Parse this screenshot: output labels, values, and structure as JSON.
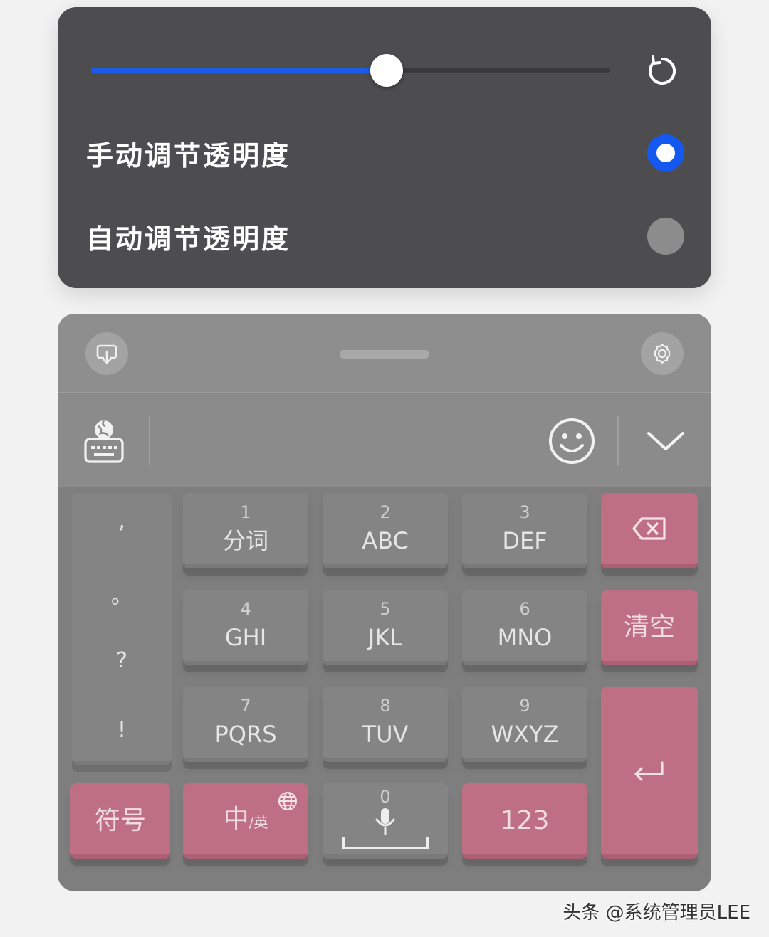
{
  "transparency_panel": {
    "slider_level": 0.57,
    "options": [
      {
        "label": "手动调节透明度",
        "selected": true
      },
      {
        "label": "自动调节透明度",
        "selected": false
      }
    ],
    "reset_icon": "reset-icon"
  },
  "keyboard": {
    "handle_left_icon": "keyboard-float-icon",
    "handle_right_icon": "gear-icon",
    "toolbar": {
      "left_icon": "keyboard-globe-icon",
      "emoji_icon": "smiley-icon",
      "collapse_icon": "chevron-down-icon"
    },
    "punctuation": [
      ",",
      "。",
      "?",
      "!"
    ],
    "keys": [
      {
        "num": "1",
        "label": "分词"
      },
      {
        "num": "2",
        "label": "ABC"
      },
      {
        "num": "3",
        "label": "DEF"
      },
      {
        "num": "4",
        "label": "GHI"
      },
      {
        "num": "5",
        "label": "JKL"
      },
      {
        "num": "6",
        "label": "MNO"
      },
      {
        "num": "7",
        "label": "PQRS"
      },
      {
        "num": "8",
        "label": "TUV"
      },
      {
        "num": "9",
        "label": "WXYZ"
      }
    ],
    "clear_label": "清空",
    "symbols_label": "符号",
    "lang_main": "中",
    "lang_sub": "/英",
    "space_num": "0",
    "num_label": "123",
    "colors": {
      "accent_pink": "#bf6f83",
      "slider_blue": "#1a5be8"
    }
  },
  "watermark": "头条 @系统管理员LEE"
}
